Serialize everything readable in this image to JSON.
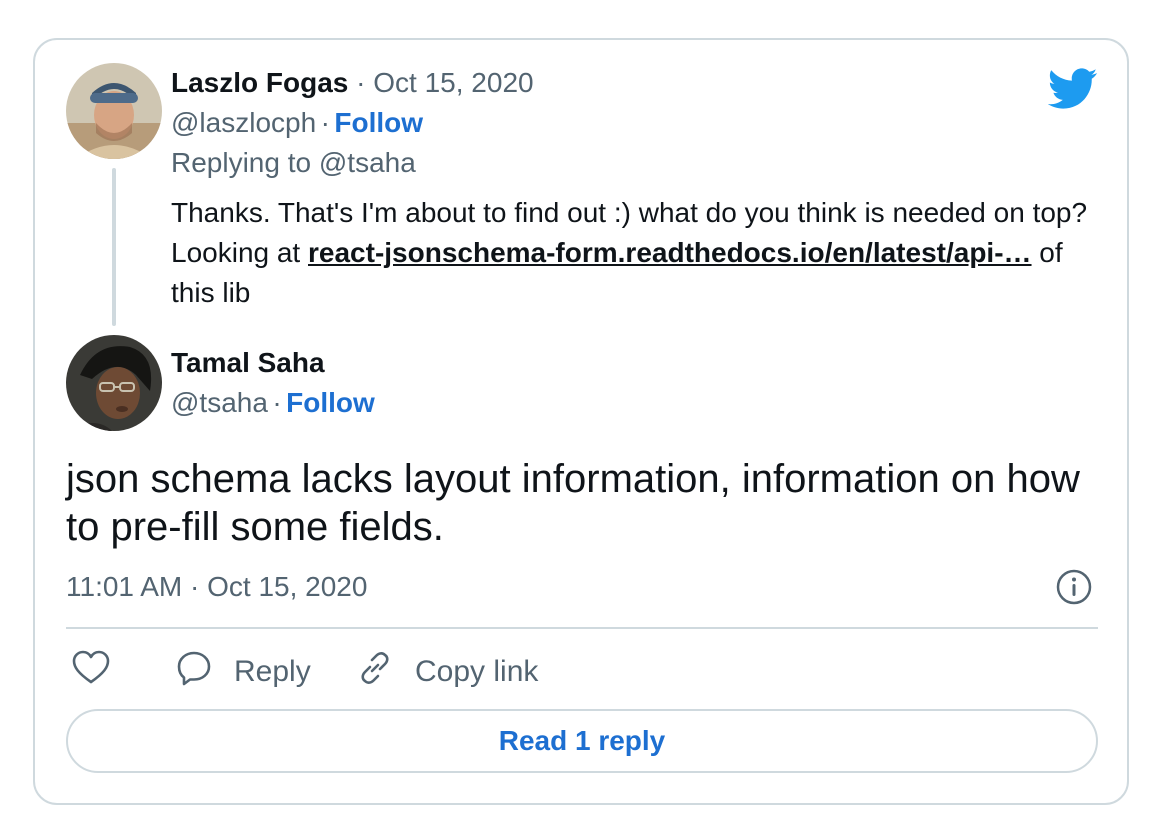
{
  "brand_color": "#1d9bf0",
  "link_color": "#1d6fd1",
  "parent_tweet": {
    "author_name": "Laszlo Fogas",
    "date": "· Oct 15, 2020",
    "handle": "@laszlocph",
    "separator": "·",
    "follow_label": "Follow",
    "replying_to": "Replying to @tsaha",
    "text_before_link": "Thanks. That's I'm about to find out :) what do you think is needed on top? Looking at ",
    "link_text": "react-jsonschema-form.readthedocs.io/en/latest/api-…",
    "text_after_link": " of this lib"
  },
  "main_tweet": {
    "author_name": "Tamal Saha",
    "handle": "@tsaha",
    "separator": "·",
    "follow_label": "Follow",
    "text": "json schema lacks layout information, information on how to pre-fill some fields.",
    "timestamp": "11:01 AM · Oct 15, 2020"
  },
  "actions": {
    "like_icon": "heart-icon",
    "reply_label": "Reply",
    "copy_link_label": "Copy link"
  },
  "read_replies_label": "Read 1 reply",
  "icons": {
    "logo": "twitter-bird-icon",
    "info": "info-icon"
  }
}
